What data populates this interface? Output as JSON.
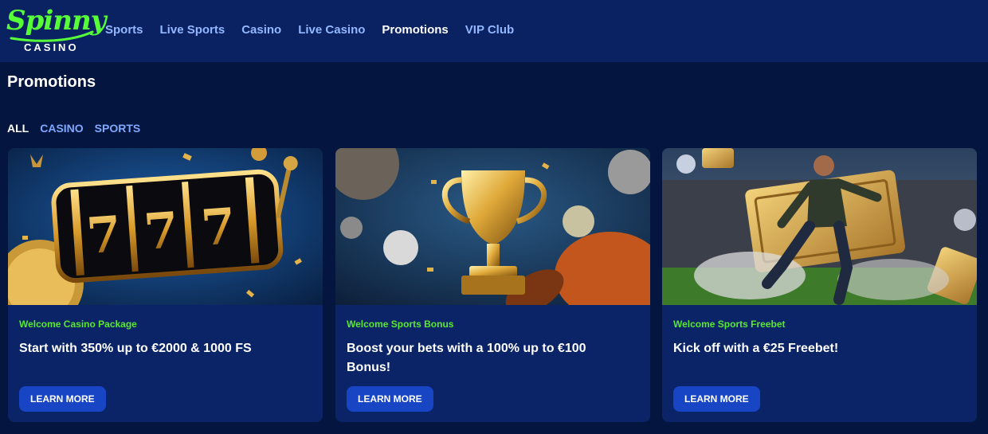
{
  "brand": {
    "name": "Spinny",
    "subtitle": "CASINO"
  },
  "nav": {
    "items": [
      "Sports",
      "Live Sports",
      "Casino",
      "Live Casino",
      "Promotions",
      "VIP Club"
    ],
    "active": "Promotions"
  },
  "page": {
    "title": "Promotions"
  },
  "filters": {
    "items": [
      "ALL",
      "CASINO",
      "SPORTS"
    ],
    "active": "ALL"
  },
  "cards": [
    {
      "category": "Welcome Casino Package",
      "title": "Start with 350% up to €2000 & 1000 FS",
      "button": "LEARN MORE",
      "image": "slot-machine-777-image"
    },
    {
      "category": "Welcome Sports Bonus",
      "title": "Boost your bets with a 100% up to €100 Bonus!",
      "button": "LEARN MORE",
      "image": "gold-trophy-image"
    },
    {
      "category": "Welcome Sports Freebet",
      "title": "Kick off with a €25 Freebet!",
      "button": "LEARN MORE",
      "image": "footballer-ticket-image"
    }
  ],
  "colors": {
    "header_bg": "#0a2262",
    "page_bg": "#04163f",
    "card_bg": "#0b2467",
    "accent_green": "#58e82f",
    "nav_link": "#93b7ff",
    "button_bg": "#1745c4"
  }
}
